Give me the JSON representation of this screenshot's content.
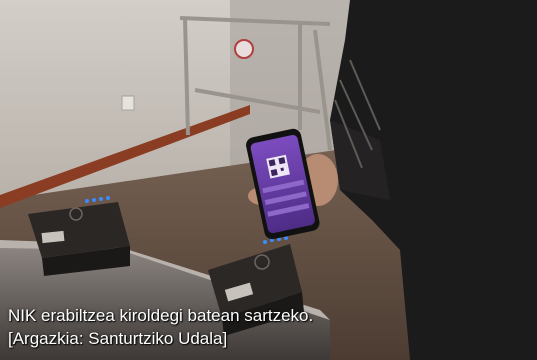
{
  "caption": {
    "line1": "NIK erabiltzea kiroldegi batean sartzeko.",
    "line2": "[Argazkia: Santurtziko Udala]"
  },
  "colors": {
    "wall": "#c9c3bd",
    "floor": "#6e5a4c",
    "baseboard": "#8a3d22",
    "phone_screen": "#6a3fa0",
    "led": "#3a8cff",
    "jacket": "#1c1b1b"
  },
  "icons": [
    "turnstile-reader-icon",
    "qr-code-icon"
  ]
}
